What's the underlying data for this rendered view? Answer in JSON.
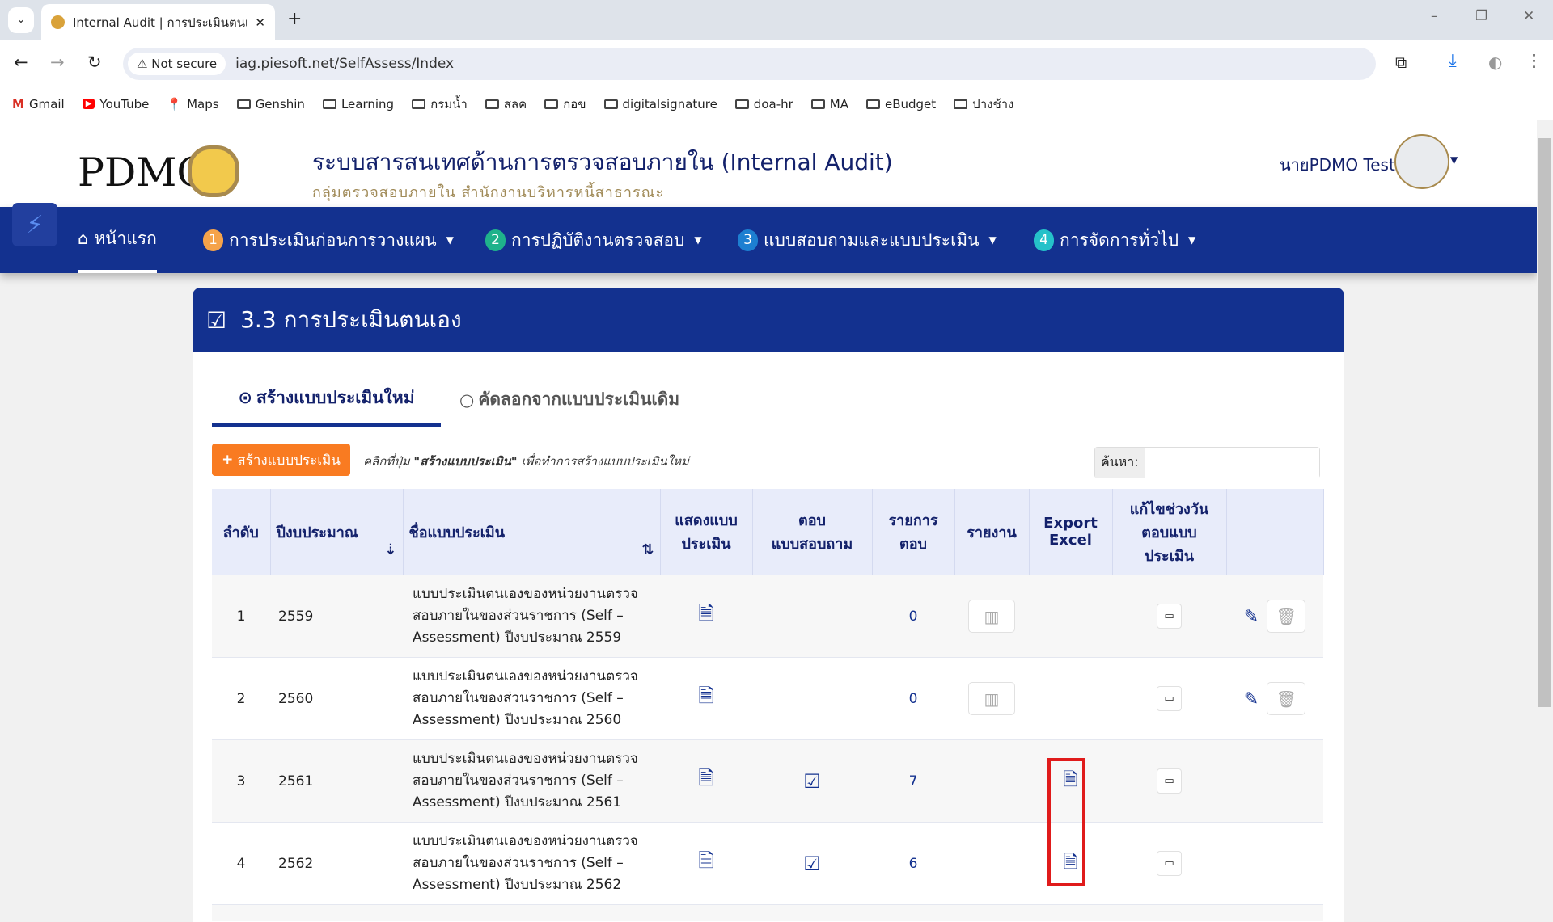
{
  "browser": {
    "tab_title": "Internal Audit | การประเมินตนเอง",
    "not_secure": "Not secure",
    "url": "iag.piesoft.net/SelfAssess/Index",
    "bookmarks": [
      "Gmail",
      "YouTube",
      "Maps",
      "Genshin",
      "Learning",
      "กรมน้ำ",
      "สลค",
      "กอข",
      "digitalsignature",
      "doa-hr",
      "MA",
      "eBudget",
      "ปางช้าง"
    ]
  },
  "header": {
    "logo": "PDMO",
    "title": "ระบบสารสนเทศด้านการตรวจสอบภายใน (Internal Audit)",
    "subtitle": "กลุ่มตรวจสอบภายใน สำนักงานบริหารหนี้สาธารณะ",
    "user": "นายPDMO Test"
  },
  "nav": {
    "home": "หน้าแรก",
    "items": [
      {
        "num": "1",
        "label": "การประเมินก่อนการวางแผน",
        "color": "#f5a34a"
      },
      {
        "num": "2",
        "label": "การปฏิบัติงานตรวจสอบ",
        "color": "#1fb28b"
      },
      {
        "num": "3",
        "label": "แบบสอบถามและแบบประเมิน",
        "color": "#1d7fd1"
      },
      {
        "num": "4",
        "label": "การจัดการทั่วไป",
        "color": "#25c1c9"
      }
    ]
  },
  "page": {
    "title": "3.3 การประเมินตนเอง",
    "tabs": [
      "สร้างแบบประเมินใหม่",
      "คัดลอกจากแบบประเมินเดิม"
    ],
    "create_button": "สร้างแบบประเมิน",
    "hint_prefix": "คลิกที่ปุ่ม ",
    "hint_bold": "\"สร้างแบบประเมิน\"",
    "hint_suffix": " เพื่อทำการสร้างแบบประเมินใหม่",
    "search_label": "ค้นหา:",
    "search_value": ""
  },
  "table": {
    "headers": [
      "ลำดับ",
      "ปีงบประมาณ",
      "ชื่อแบบประเมิน",
      "แสดงแบบประเมิน",
      "ตอบแบบสอบถาม",
      "รายการตอบ",
      "รายงาน",
      "Export Excel",
      "แก้ไขช่วงวันตอบแบบประเมิน",
      ""
    ],
    "rows": [
      {
        "no": "1",
        "year": "2559",
        "name": "แบบประเมินตนเองของหน่วยงานตรวจสอบภายในของส่วนราชการ (Self – Assessment) ปีงบประมาณ 2559",
        "count": "0"
      },
      {
        "no": "2",
        "year": "2560",
        "name": "แบบประเมินตนเองของหน่วยงานตรวจสอบภายในของส่วนราชการ (Self – Assessment) ปีงบประมาณ 2560",
        "count": "0"
      },
      {
        "no": "3",
        "year": "2561",
        "name": "แบบประเมินตนเองของหน่วยงานตรวจสอบภายในของส่วนราชการ (Self – Assessment) ปีงบประมาณ 2561",
        "count": "7"
      },
      {
        "no": "4",
        "year": "2562",
        "name": "แบบประเมินตนเองของหน่วยงานตรวจสอบภายในของส่วนราชการ (Self – Assessment) ปีงบประมาณ 2562",
        "count": "6"
      }
    ]
  }
}
